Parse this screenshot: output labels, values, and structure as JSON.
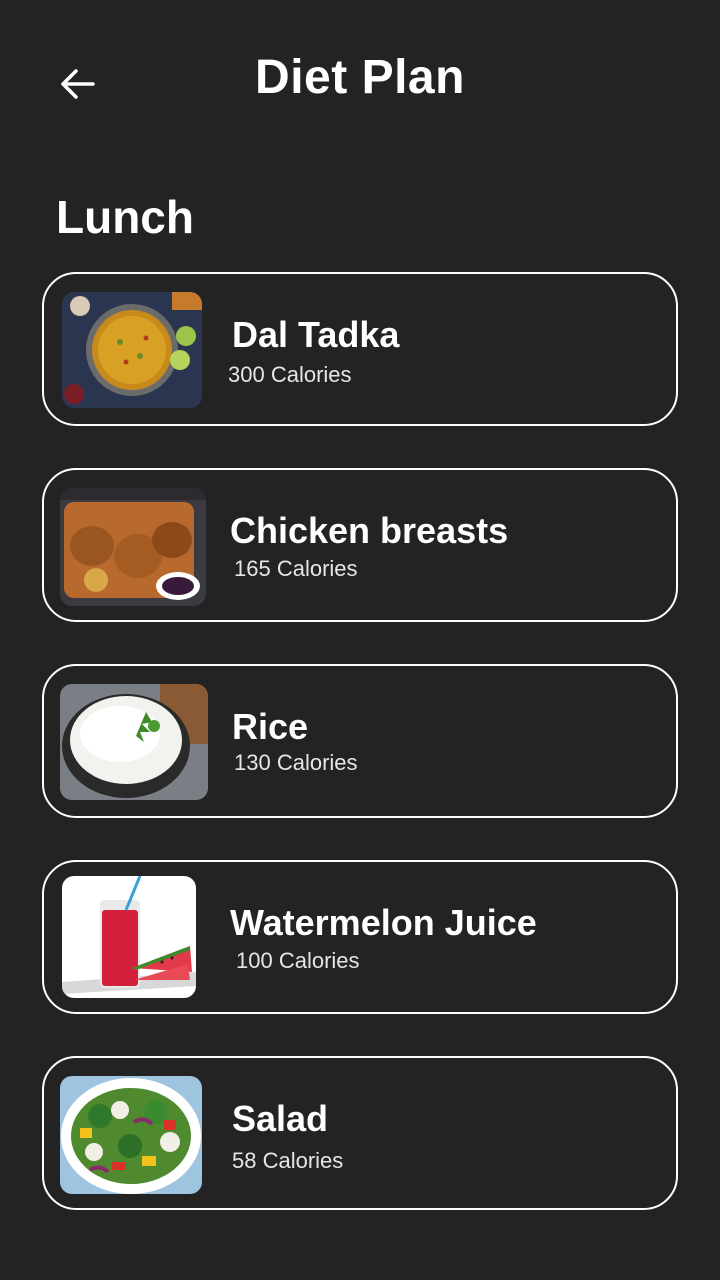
{
  "header": {
    "title": "Diet Plan",
    "back_icon": "arrow-left-icon"
  },
  "section": {
    "title": "Lunch"
  },
  "meals": [
    {
      "name": "Dal Tadka",
      "calories": "300 Calories",
      "image": "dal-tadka-image"
    },
    {
      "name": "Chicken breasts",
      "calories": "165 Calories",
      "image": "chicken-breasts-image"
    },
    {
      "name": "Rice",
      "calories": "130 Calories",
      "image": "rice-image"
    },
    {
      "name": "Watermelon Juice",
      "calories": "100 Calories",
      "image": "watermelon-juice-image"
    },
    {
      "name": "Salad",
      "calories": "58 Calories",
      "image": "salad-image"
    }
  ],
  "colors": {
    "background": "#232323",
    "text": "#ffffff",
    "card_border": "#ffffff"
  }
}
